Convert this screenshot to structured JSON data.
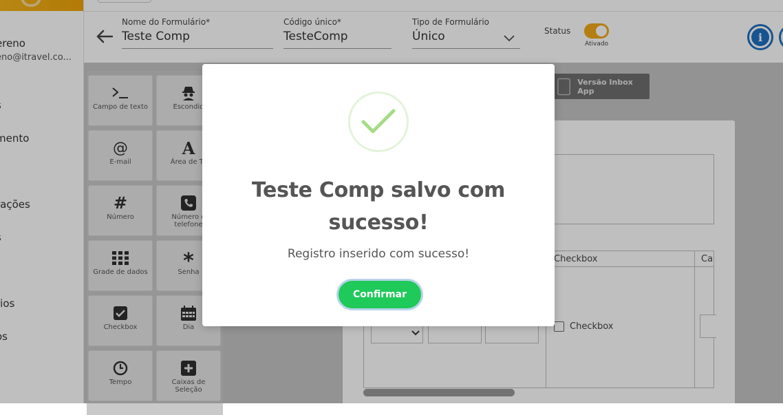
{
  "sidebar": {
    "user_name": "ereno",
    "user_email": "eno@itravel.co...",
    "menu": [
      "s",
      "mento",
      "rações",
      "s",
      "rios",
      "os"
    ]
  },
  "header": {
    "form_name_label": "Nome do Formulário*",
    "form_name_value": "Teste Comp",
    "unique_code_label": "Código único*",
    "unique_code_value": "TesteComp",
    "form_type_label": "Tipo de Formulário",
    "form_type_value": "Único",
    "status_label": "Status",
    "status_value": "Ativado",
    "info_icon_text": "i"
  },
  "toolbar": {
    "inbox_app_button": "Versão Inbox App"
  },
  "palette": {
    "tiles": [
      {
        "icon": "terminal-icon",
        "label": "Campo de texto"
      },
      {
        "icon": "spy-icon",
        "label": "Escondid"
      },
      {
        "icon": "at-icon",
        "label": "E-mail"
      },
      {
        "icon": "font-icon",
        "label": "Área de Te"
      },
      {
        "icon": "hash-icon",
        "label": "Número"
      },
      {
        "icon": "phone-icon",
        "label": "Número d telefone"
      },
      {
        "icon": "grid-icon",
        "label": "Grade de dados"
      },
      {
        "icon": "asterisk-icon",
        "label": "Senha"
      },
      {
        "icon": "checkbox-icon",
        "label": "Checkbox"
      },
      {
        "icon": "calendar-icon",
        "label": "Dia"
      },
      {
        "icon": "clock-icon",
        "label": "Tempo"
      },
      {
        "icon": "plus-square-icon",
        "label": "Caixas de Seleção"
      }
    ]
  },
  "canvas": {
    "grid_col_checkbox": "Checkbox",
    "grid_col_next": "Ca",
    "checkbox_label": "Checkbox"
  },
  "modal": {
    "title": "Teste Comp salvo com sucesso!",
    "message": "Registro inserido com sucesso!",
    "confirm_label": "Confirmar"
  },
  "colors": {
    "accent": "#f0a818",
    "confirm": "#1fc95a",
    "info": "#1f6fc0"
  }
}
